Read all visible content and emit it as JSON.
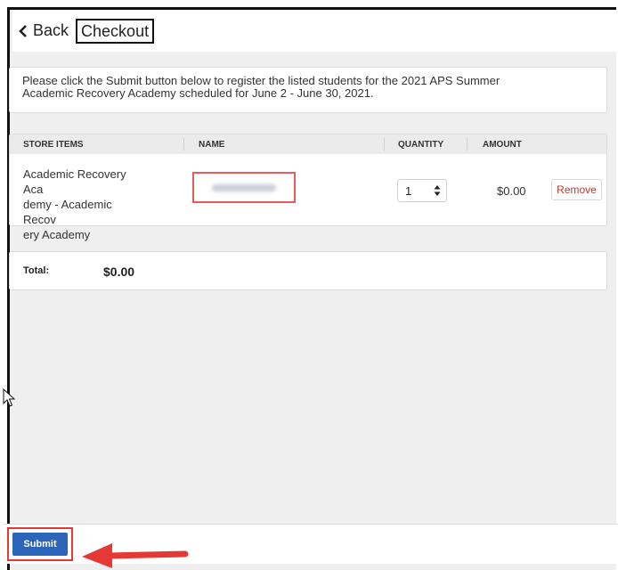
{
  "header": {
    "back_label": "Back",
    "title": "Checkout"
  },
  "instructions": {
    "line1": "Please click the Submit button below to register the listed students for the 2021 APS Summer",
    "line2": "Academic Recovery Academy scheduled for June 2 - June 30, 2021."
  },
  "table": {
    "columns": [
      "STORE ITEMS",
      "NAME",
      "QUANTITY",
      "AMOUNT"
    ],
    "rows": [
      {
        "item_line1": "Academic Recovery Aca",
        "item_line2": "demy - Academic Recov",
        "item_line3": "ery Academy",
        "quantity": "1",
        "amount": "$0.00",
        "remove_label": "Remove"
      }
    ]
  },
  "total": {
    "label": "Total:",
    "value": "$0.00"
  },
  "footer": {
    "submit_label": "Submit"
  },
  "colors": {
    "submit": "#2b64b8",
    "highlight": "#e53935",
    "remove_text": "#c0392b"
  }
}
